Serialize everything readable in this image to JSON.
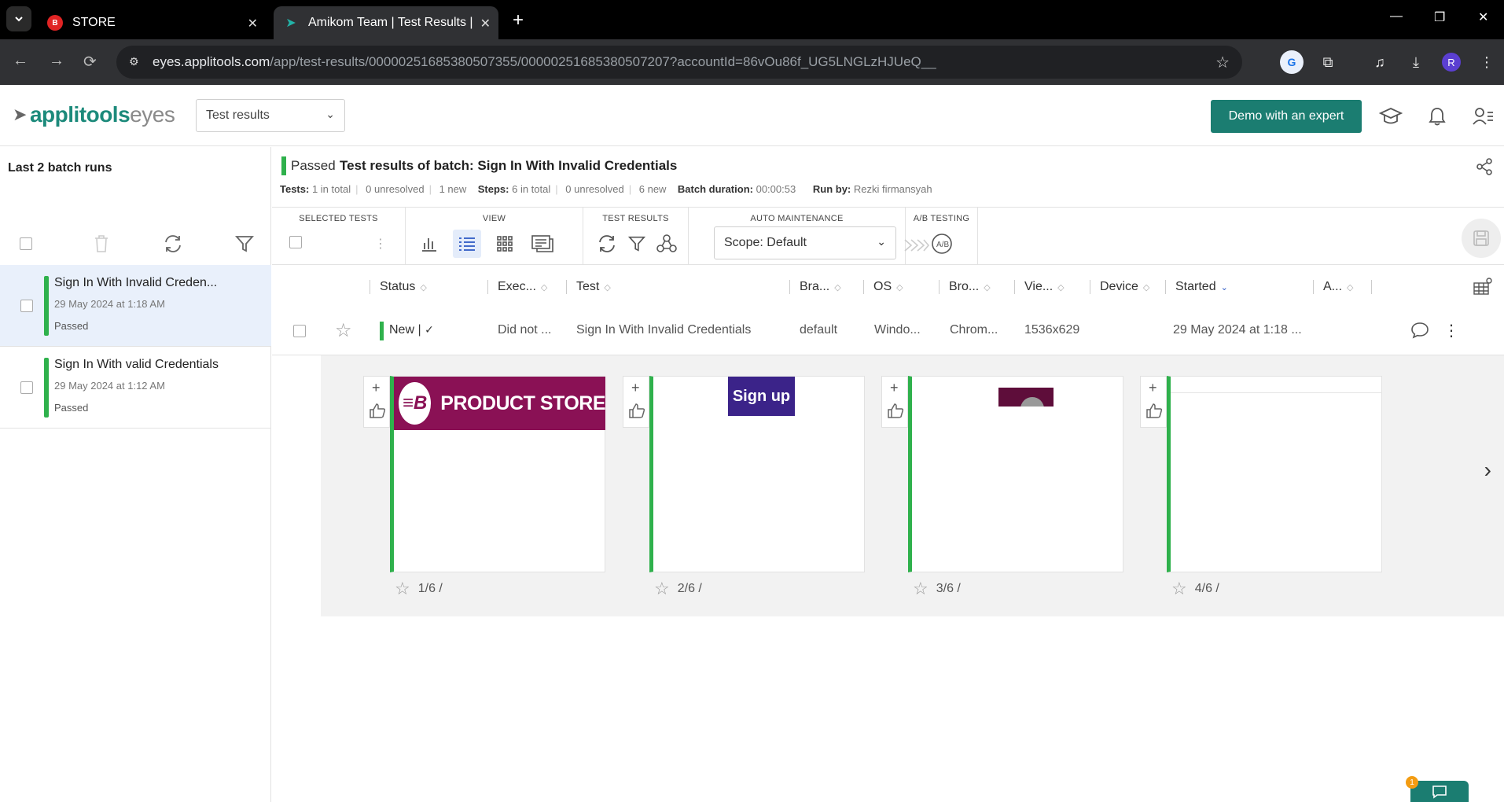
{
  "browser": {
    "tabs": [
      {
        "title": "STORE",
        "favicon": "store-favicon"
      },
      {
        "title": "Amikom Team | Test Results | Ap",
        "favicon": "applitools-favicon"
      }
    ],
    "url_host": "eyes.applitools.com",
    "url_path": "/app/test-results/00000251685380507355/00000251685380507207?accountId=86vOu86f_UG5LNGLzHJUeQ__",
    "profile_initial": "R"
  },
  "header": {
    "logo_a": "applitools",
    "logo_b": "eyes",
    "page_select": "Test results",
    "demo_button": "Demo with an expert"
  },
  "left": {
    "title": "Last 2 batch runs",
    "batches": [
      {
        "name": "Sign In With Invalid Creden...",
        "date": "29 May 2024 at 1:18 AM",
        "status": "Passed"
      },
      {
        "name": "Sign In With valid Credentials",
        "date": "29 May 2024 at 1:12 AM",
        "status": "Passed"
      }
    ]
  },
  "batch": {
    "status": "Passed",
    "title_prefix": "Test results of batch:",
    "title": "Sign In With Invalid Credentials",
    "tests_label": "Tests:",
    "tests_total": "1 in total",
    "tests_unresolved": "0 unresolved",
    "tests_new": "1 new",
    "steps_label": "Steps:",
    "steps_total": "6 in total",
    "steps_unresolved": "0 unresolved",
    "steps_new": "6 new",
    "duration_label": "Batch duration:",
    "duration": "00:00:53",
    "runby_label": "Run by:",
    "runby": "Rezki firmansyah"
  },
  "toolbar": {
    "selected_tests": "SELECTED TESTS",
    "view": "VIEW",
    "test_results": "TEST RESULTS",
    "auto_maintenance": "AUTO MAINTENANCE",
    "ab_testing": "A/B TESTING",
    "scope": "Scope: Default"
  },
  "table": {
    "columns": [
      "Status",
      "Exec...",
      "Test",
      "Bra...",
      "OS",
      "Bro...",
      "Vie...",
      "Device",
      "Started",
      "A..."
    ],
    "row": {
      "status": "New |",
      "exec": "Did not ...",
      "test": "Sign In With Invalid Credentials",
      "branch": "default",
      "os": "Windo...",
      "browser": "Chrom...",
      "viewport": "1536x629",
      "started": "29 May 2024 at 1:18 ..."
    }
  },
  "steps": [
    {
      "caption": "1/6 /",
      "preview_text": "PRODUCT STORE"
    },
    {
      "caption": "2/6 /",
      "preview_text": "Sign up"
    },
    {
      "caption": "3/6 /"
    },
    {
      "caption": "4/6 /"
    }
  ],
  "chat": {
    "badge": "1"
  },
  "colors": {
    "accent": "#1b7d71",
    "passed": "#2fb14c",
    "brand_store": "#8a1155"
  }
}
